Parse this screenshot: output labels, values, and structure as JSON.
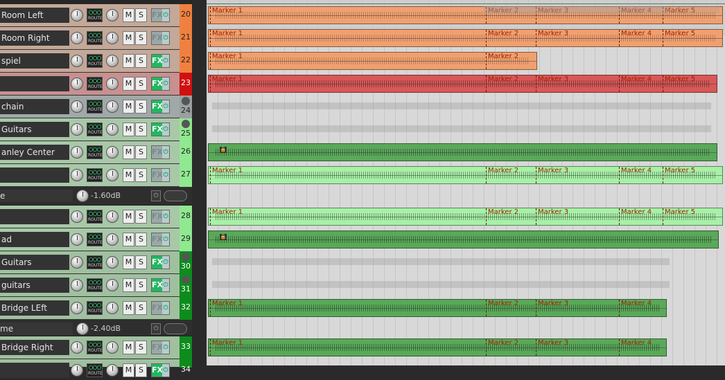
{
  "colors": {
    "orange": "#f0a070",
    "red": "#d85858",
    "lightgreen": "#a8f0a8",
    "green": "#5aa85a",
    "darkgreen": "#0c8c1c",
    "fxOn": "#20b860",
    "fxOff": "#9aa8a8"
  },
  "labels": {
    "route": "ROUTE",
    "mute": "M",
    "solo": "S",
    "fx": "FX",
    "power": "⏻"
  },
  "tracks": [
    {
      "num": "20",
      "name": "Room Left",
      "bg": "#c4a898",
      "numbg": "#f08040",
      "fx": false,
      "item": "orange",
      "markers": [
        "Marker 1",
        "Marker 2",
        "Marker 3",
        "Marker 4",
        "Marker 5"
      ]
    },
    {
      "num": "21",
      "name": "Room Right",
      "bg": "#c4a898",
      "numbg": "#f08040",
      "fx": false,
      "item": "orange",
      "markers": [
        "Marker 1",
        "Marker 2",
        "Marker 3",
        "Marker 4",
        "Marker 5"
      ]
    },
    {
      "num": "22",
      "name": "spiel",
      "bg": "#c4a898",
      "numbg": "#f08040",
      "fx": true,
      "item": "orange",
      "markers": [
        "Marker 1",
        "Marker 2"
      ]
    },
    {
      "num": "23",
      "name": "",
      "bg": "#c89090",
      "numbg": "#d01010",
      "fx": true,
      "item": "red",
      "markers": [
        "Marker 1",
        "Marker 2",
        "Marker 3",
        "Marker 4",
        "Marker 5"
      ]
    },
    {
      "num": "24",
      "name": "chain",
      "bg": "#a0a8a8",
      "numbg": "#9aa0a0",
      "fx": true,
      "folder": true,
      "item": "ghost",
      "markers": []
    },
    {
      "num": "25",
      "name": "Guitars",
      "bg": "#a8c8a8",
      "numbg": "#90e890",
      "fx": true,
      "folder": true,
      "item": "ghost",
      "markers": []
    },
    {
      "num": "26",
      "name": "anley Center",
      "bg": "#a8c8a8",
      "numbg": "#90e890",
      "fx": false,
      "item": "green",
      "lock": true,
      "markers": []
    },
    {
      "num": "27",
      "name": "",
      "bg": "#a8c8a8",
      "numbg": "#90e890",
      "fx": false,
      "item": "lightgreen",
      "markers": [
        "Marker 1",
        "Marker 2",
        "Marker 3",
        "Marker 4",
        "Marker 5"
      ]
    },
    {
      "env": true,
      "name": "e",
      "value": "-1.60dB"
    },
    {
      "num": "28",
      "name": "",
      "bg": "#a8c8a8",
      "numbg": "#90e890",
      "fx": false,
      "item": "lightgreen",
      "markers": [
        "Marker 1",
        "Marker 2",
        "Marker 3",
        "Marker 4",
        "Marker 5"
      ]
    },
    {
      "num": "29",
      "name": "ad",
      "bg": "#a8c8a8",
      "numbg": "#90e890",
      "fx": false,
      "item": "green",
      "lock": true,
      "markers": []
    },
    {
      "num": "30",
      "name": "Guitars",
      "bg": "#a0c0a0",
      "numbg": "#0c8c1c",
      "fx": true,
      "folder": true,
      "item": "ghost",
      "markers": []
    },
    {
      "num": "31",
      "name": "guitars",
      "bg": "#a0c0a0",
      "numbg": "#0c8c1c",
      "fx": true,
      "folder": true,
      "item": "ghost",
      "markers": []
    },
    {
      "num": "32",
      "name": "Bridge LEft",
      "bg": "#a0c0a0",
      "numbg": "#0c8c1c",
      "fx": false,
      "item": "green",
      "markers": [
        "Marker 1",
        "Marker 2",
        "Marker 3",
        "Marker 4"
      ]
    },
    {
      "env": true,
      "name": "me",
      "value": "-2.40dB"
    },
    {
      "num": "33",
      "name": "Bridge Right",
      "bg": "#a0c0a0",
      "numbg": "#0c8c1c",
      "fx": false,
      "item": "green",
      "markers": [
        "Marker 1",
        "Marker 2",
        "Marker 3",
        "Marker 4"
      ]
    },
    {
      "num": "34",
      "name": "",
      "bg": "#a0c0a0",
      "numbg": "#0c8c1c",
      "fx": true,
      "item": "none",
      "markers": []
    }
  ]
}
